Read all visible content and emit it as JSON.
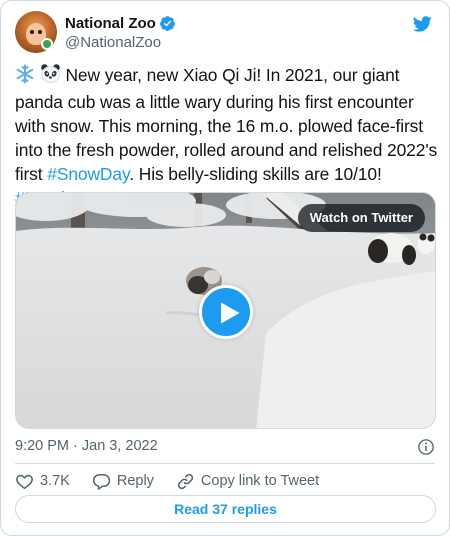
{
  "author": {
    "display_name": "National Zoo",
    "handle": "@NationalZoo",
    "verified": true
  },
  "tweet": {
    "emoji_1": "❄️",
    "emoji_2": "🐼",
    "text_1": " New year, new Xiao Qi Ji! In 2021, our giant panda cub was a little wary during his first encounter with snow. This morning, the 16 m.o. plowed face-first into the fresh powder, rolled around and relished 2022's first ",
    "hashtag_1": "#SnowDay",
    "text_2": ". His belly-sliding skills are 10/10! ",
    "hashtag_2": "#PandaStory"
  },
  "media": {
    "watch_label": "Watch on Twitter",
    "play_icon": "play-icon"
  },
  "meta": {
    "timestamp": "9:20 PM · Jan 3, 2022"
  },
  "actions": {
    "like_count": "3.7K",
    "reply_label": "Reply",
    "copy_link_label": "Copy link to Tweet"
  },
  "footer": {
    "read_replies_label": "Read 37 replies"
  },
  "colors": {
    "accent": "#1d9bf0",
    "text": "#0f1419",
    "muted": "#536471",
    "border": "#cfd9de"
  }
}
